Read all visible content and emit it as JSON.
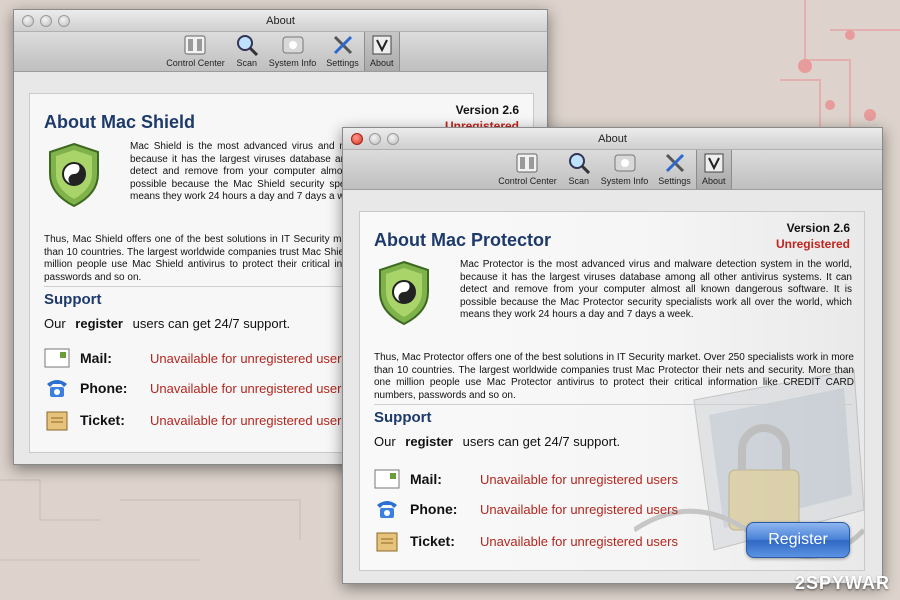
{
  "window1": {
    "title": "About",
    "toolbar": [
      {
        "label": "Control Center",
        "icon": "control-center-icon"
      },
      {
        "label": "Scan",
        "icon": "magnifier-icon"
      },
      {
        "label": "System Info",
        "icon": "apple-icon"
      },
      {
        "label": "Settings",
        "icon": "tools-icon"
      },
      {
        "label": "About",
        "icon": "about-icon"
      }
    ],
    "version": "Version 2.6",
    "status": "Unregistered",
    "heading": "About Mac Shield",
    "description": "Mac Shield is the most advanced virus and malware detection system in the world,  because it has the largest viruses database among all other antivirus systems. It can detect and remove from your computer almost all known dangerous software. It is possible because the Mac Shield security specialists work all over the world, which means they work 24 hours a day and  7 days a week.",
    "description2": "Thus, Mac Shield offers one of the best solutions in IT Security market. Over 250 specialists work in more than 10 countries. The largest worldwide companies trust Mac Shield their nets and security. More than one million people use Mac Shield antivirus to protect their critical information like CREDIT CARD numbers, passwords and so on.",
    "support_heading": "Support",
    "support_prefix": "Our",
    "support_register": "register",
    "support_suffix": "users can get 24/7 support.",
    "rows": [
      {
        "label": "Mail:",
        "status": "Unavailable for unregistered users"
      },
      {
        "label": "Phone:",
        "status": "Unavailable for unregistered users"
      },
      {
        "label": "Ticket:",
        "status": "Unavailable for unregistered users"
      }
    ]
  },
  "window2": {
    "title": "About",
    "toolbar": [
      {
        "label": "Control Center",
        "icon": "control-center-icon"
      },
      {
        "label": "Scan",
        "icon": "magnifier-icon"
      },
      {
        "label": "System Info",
        "icon": "apple-icon"
      },
      {
        "label": "Settings",
        "icon": "tools-icon"
      },
      {
        "label": "About",
        "icon": "about-icon"
      }
    ],
    "version": "Version 2.6",
    "status": "Unregistered",
    "heading": "About Mac Protector",
    "description": "Mac Protector is the most advanced virus and malware detection system in the world,  because it has the largest viruses database among all other antivirus systems. It can detect and remove from your computer almost all known dangerous software. It is possible because the Mac Protector security specialists work all over the world, which means they work 24 hours a day and  7 days a week.",
    "description2": "Thus, Mac Protector offers one of the best solutions in IT Security market. Over 250 specialists work in more than 10 countries. The largest worldwide companies trust Mac Protector their nets and security. More than one million people use Mac Protector antivirus to protect their critical information like CREDIT CARD numbers, passwords and so on.",
    "support_heading": "Support",
    "support_prefix": "Our",
    "support_register": "register",
    "support_suffix": "users can get 24/7 support.",
    "rows": [
      {
        "label": "Mail:",
        "status": "Unavailable for unregistered users"
      },
      {
        "label": "Phone:",
        "status": "Unavailable for unregistered users"
      },
      {
        "label": "Ticket:",
        "status": "Unavailable for unregistered users"
      }
    ],
    "register_button": "Register"
  },
  "watermark": "2SPYWAR",
  "colors": {
    "heading": "#1d3a6b",
    "unavailable": "#b3261e",
    "unregistered": "#c0241c",
    "register_button": "#4a82d8"
  }
}
